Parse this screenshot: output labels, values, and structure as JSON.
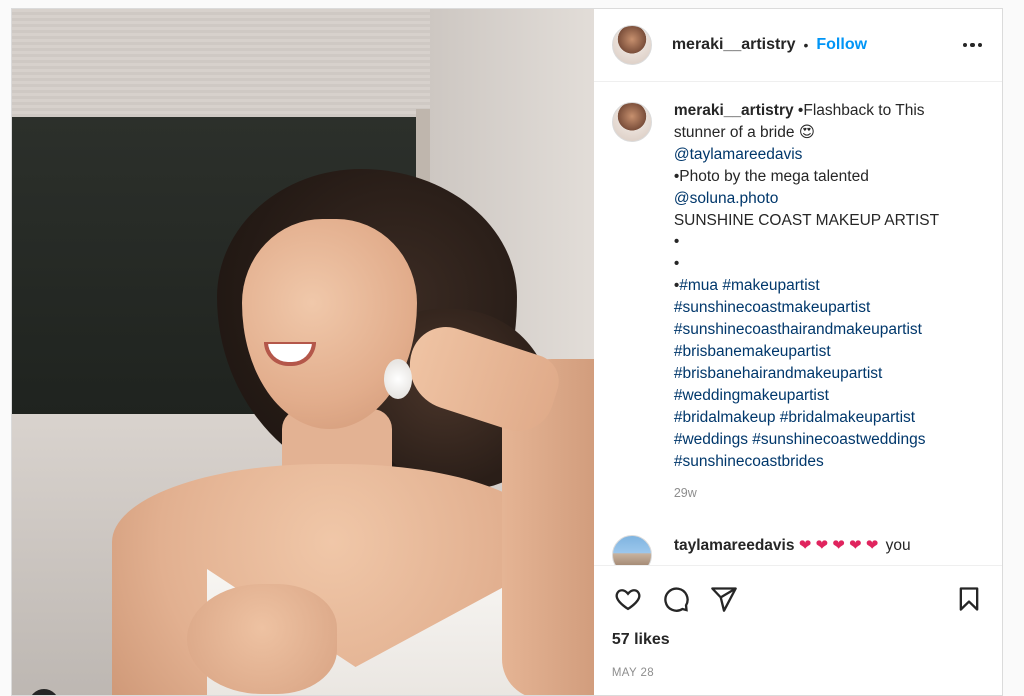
{
  "post": {
    "username": "meraki__artistry",
    "follow_label": "Follow",
    "separator": "•"
  },
  "caption": {
    "username": "meraki__artistry",
    "lines": [
      {
        "text": "•Flashback to This",
        "type": "text"
      },
      {
        "text": "stunner of a bride 😍",
        "type": "text"
      },
      {
        "text": "@taylamareedavis",
        "type": "link"
      },
      {
        "text": "•Photo by the mega talented",
        "type": "text"
      },
      {
        "text": "@soluna.photo",
        "type": "link"
      },
      {
        "text": "SUNSHINE COAST MAKEUP ARTIST",
        "type": "text"
      },
      {
        "text": "•",
        "type": "text"
      },
      {
        "text": "•",
        "type": "text"
      }
    ],
    "hashtag_lead": "•",
    "hashtag_lines": [
      "#mua #makeupartist",
      "#sunshinecoastmakeupartist",
      "#sunshinecoasthairandmakeupartist",
      "#brisbanemakeupartist",
      "#brisbanehairandmakeupartist",
      "#weddingmakeupartist",
      "#bridalmakeup #bridalmakeupartist",
      "#weddings #sunshinecoastweddings",
      "#sunshinecoastbrides"
    ],
    "time_ago": "29w"
  },
  "comment": {
    "username": "taylamareedavis",
    "hearts": "❤ ❤ ❤ ❤ ❤",
    "text": "you"
  },
  "actions": {
    "like_icon": "heart-outline-icon",
    "comment_icon": "comment-bubble-icon",
    "share_icon": "paper-plane-icon",
    "save_icon": "bookmark-icon"
  },
  "likes": "57 likes",
  "date": "MAY 28",
  "colors": {
    "link": "#00376b",
    "follow": "#0095f6",
    "muted": "#8e8e8e",
    "heart": "#e0245e"
  }
}
